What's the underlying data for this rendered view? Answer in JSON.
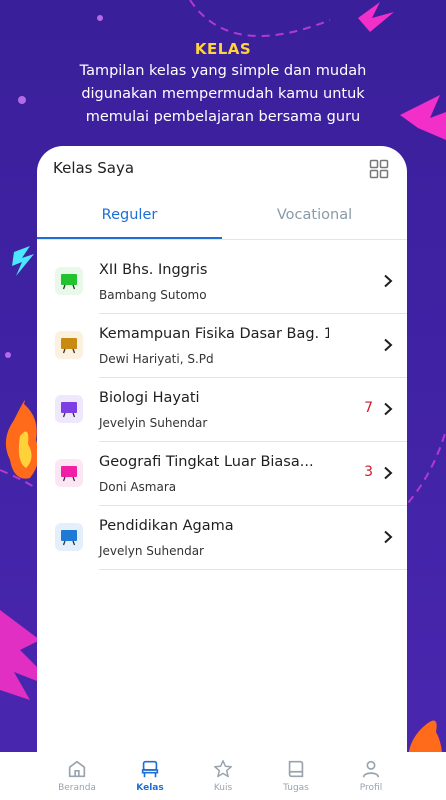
{
  "hero": {
    "title": "KELAS",
    "description": "Tampilan kelas yang simple dan mudah digunakan mempermudah kamu untuk memulai pembelajaran bersama guru"
  },
  "app": {
    "title": "Kelas Saya",
    "grid_icon": "grid-icon",
    "tabs": [
      {
        "label": "Reguler",
        "active": true
      },
      {
        "label": "Vocational",
        "active": false
      }
    ]
  },
  "classes": [
    {
      "title": "XII Bhs. Inggris",
      "teacher": "Bambang Sutomo",
      "badge": "",
      "icon_color": "#22c32e",
      "icon_bg": "#e8f8e9"
    },
    {
      "title": "Kemampuan Fisika Dasar Bag. 1",
      "teacher": "Dewi Hariyati, S.Pd",
      "badge": "",
      "icon_color": "#c98a12",
      "icon_bg": "#fbf1de"
    },
    {
      "title": "Biologi Hayati",
      "teacher": "Jevelyin Suhendar",
      "badge": "7",
      "icon_color": "#7b3fe4",
      "icon_bg": "#efe7fc"
    },
    {
      "title": "Geografi Tingkat Luar Biasa...",
      "teacher": "Doni Asmara",
      "badge": "3",
      "icon_color": "#ef1fa6",
      "icon_bg": "#fde6f4"
    },
    {
      "title": "Pendidikan Agama",
      "teacher": "Jevelyn Suhendar",
      "badge": "",
      "icon_color": "#1f7ad6",
      "icon_bg": "#e3effb"
    }
  ],
  "bottom_nav": [
    {
      "label": "Beranda",
      "icon": "home-icon",
      "active": false
    },
    {
      "label": "Kelas",
      "icon": "chair-icon",
      "active": true
    },
    {
      "label": "Kuis",
      "icon": "star-icon",
      "active": false
    },
    {
      "label": "Tugas",
      "icon": "book-icon",
      "active": false
    },
    {
      "label": "Profil",
      "icon": "user-icon",
      "active": false
    }
  ],
  "colors": {
    "background": "#3f22a3",
    "accent": "#1d6fd6",
    "hero_title": "#ffd43b",
    "badge": "#d11a2a"
  }
}
